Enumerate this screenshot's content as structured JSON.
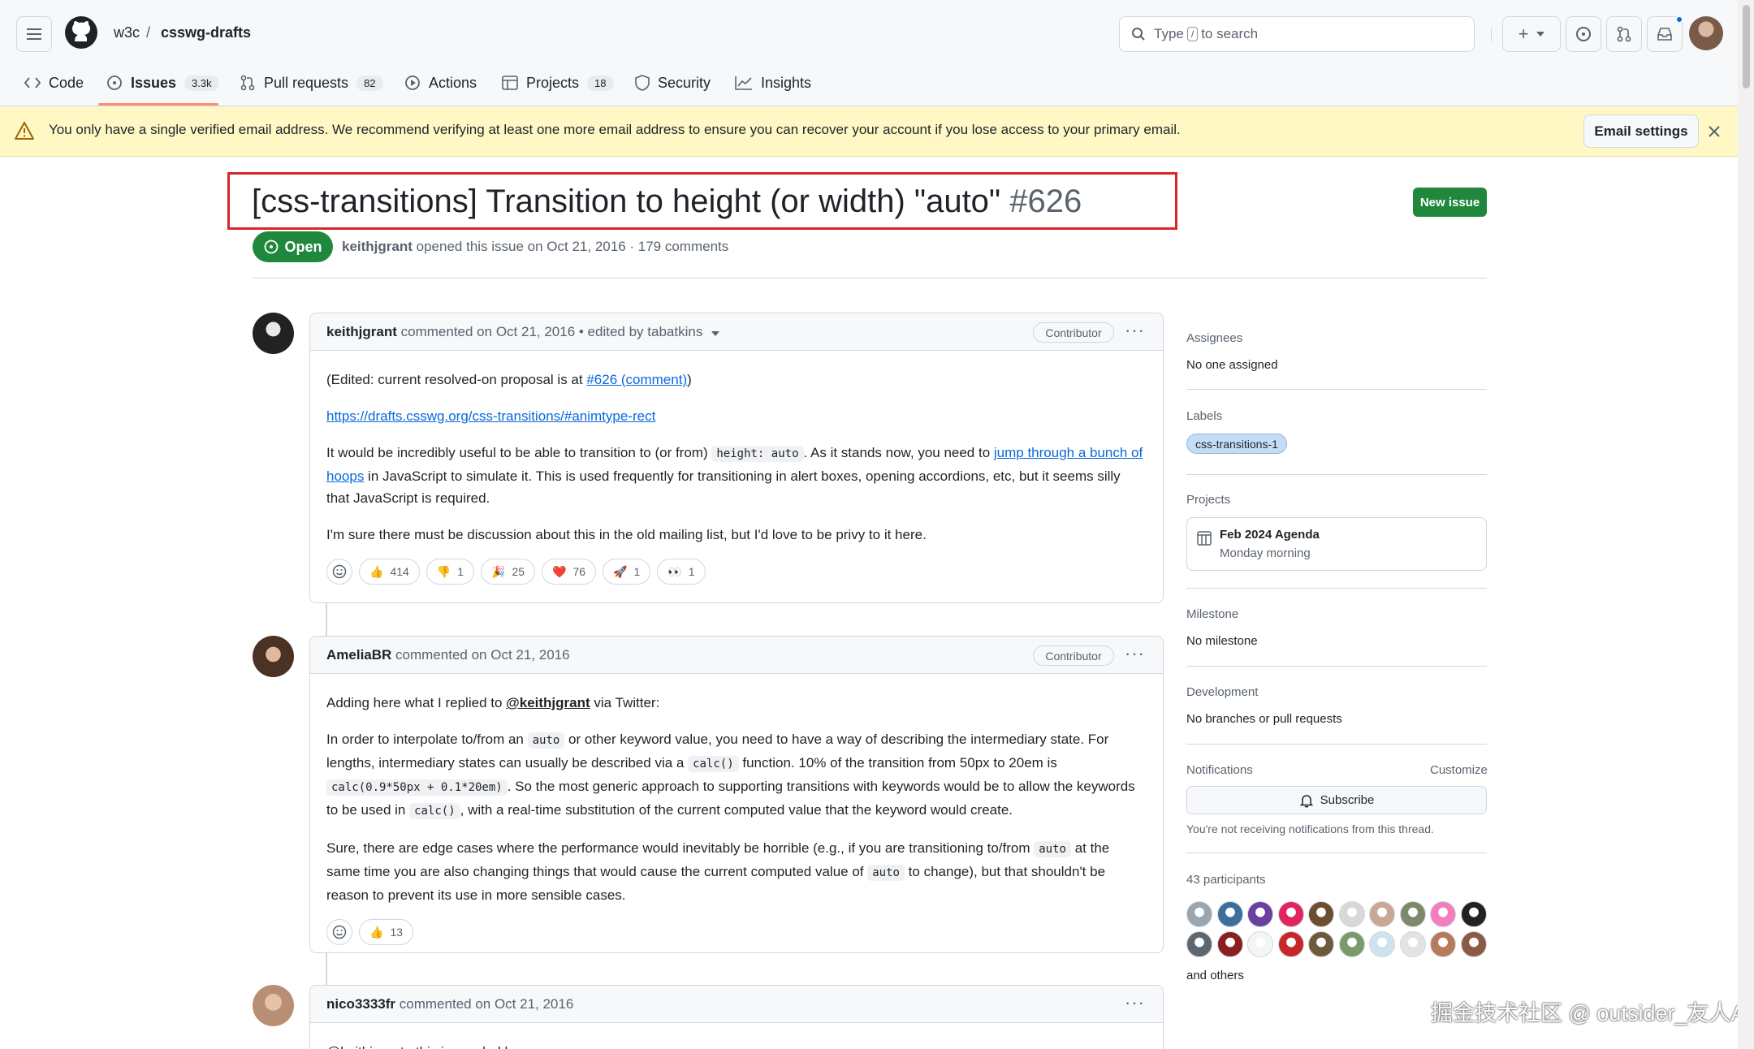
{
  "header": {
    "org": "w3c",
    "separator": "/",
    "repo": "csswg-drafts",
    "search_prefix": "Type",
    "search_key": "/",
    "search_suffix": "to search",
    "plus": "+",
    "tabs": [
      {
        "label": "Code"
      },
      {
        "label": "Issues",
        "count": "3.3k"
      },
      {
        "label": "Pull requests",
        "count": "82"
      },
      {
        "label": "Actions"
      },
      {
        "label": "Projects",
        "count": "18"
      },
      {
        "label": "Security"
      },
      {
        "label": "Insights"
      }
    ]
  },
  "banner": {
    "text": "You only have a single verified email address. We recommend verifying at least one more email address to ensure you can recover your account if you lose access to your primary email.",
    "button": "Email settings"
  },
  "issue": {
    "title": "[css-transitions] Transition to height (or width) \"auto\"",
    "number": "#626",
    "new_issue": "New issue",
    "state": "Open",
    "author": "keithjgrant",
    "meta": "opened this issue on Oct 21, 2016 · 179 comments"
  },
  "comments": [
    {
      "author": "keithjgrant",
      "meta": "commented on Oct 21, 2016 • edited by tabatkins",
      "badge": "Contributor",
      "p1_pre": "(Edited: current resolved-on proposal is at ",
      "p1_link": "#626 (comment)",
      "p1_post": ")",
      "p2_link": "https://drafts.csswg.org/css-transitions/#animtype-rect",
      "p3_a": "It would be incredibly useful to be able to transition to (or from) ",
      "p3_code": "height: auto",
      "p3_b": ". As it stands now, you need to ",
      "p3_link": "jump through a bunch of hoops",
      "p3_c": " in JavaScript to simulate it. This is used frequently for transitioning in alert boxes, opening accordions, etc, but it seems silly that JavaScript is required.",
      "p4": "I'm sure there must be discussion about this in the old mailing list, but I'd love to be privy to it here.",
      "reactions": [
        {
          "emoji": "👍",
          "count": "414"
        },
        {
          "emoji": "👎",
          "count": "1"
        },
        {
          "emoji": "🎉",
          "count": "25"
        },
        {
          "emoji": "❤️",
          "count": "76"
        },
        {
          "emoji": "🚀",
          "count": "1"
        },
        {
          "emoji": "👀",
          "count": "1"
        }
      ]
    },
    {
      "author": "AmeliaBR",
      "meta": "commented on Oct 21, 2016",
      "badge": "Contributor",
      "p1_a": "Adding here what I replied to ",
      "p1_link": "@keithjgrant",
      "p1_b": " via Twitter:",
      "p2_a": "In order to interpolate to/from an ",
      "p2_code1": "auto",
      "p2_b": " or other keyword value, you need to have a way of describing the intermediary state. For lengths, intermediary states can usually be described via a ",
      "p2_code2": "calc()",
      "p2_c": " function. 10% of the transition from 50px to 20em is ",
      "p2_code3": "calc(0.9*50px + 0.1*20em)",
      "p2_d": ". So the most generic approach to supporting transitions with keywords would be to allow the keywords to be used in ",
      "p2_code4": "calc()",
      "p2_e": ", with a real-time substitution of the current computed value that the keyword would create.",
      "p3_a": "Sure, there are edge cases where the performance would inevitably be horrible (e.g., if you are transitioning to/from ",
      "p3_code1": "auto",
      "p3_b": " at the same time you are also changing things that would cause the current computed value of ",
      "p3_code2": "auto",
      "p3_c": " to change), but that shouldn't be reason to prevent its use in more sensible cases.",
      "reactions": [
        {
          "emoji": "👍",
          "count": "13"
        }
      ]
    },
    {
      "author": "nico3333fr",
      "meta": "commented on Oct 21, 2016",
      "body_start": "@keithjgrant : this is needed because"
    }
  ],
  "sidebar": {
    "assignees_h": "Assignees",
    "assignees_v": "No one assigned",
    "labels_h": "Labels",
    "label": "css-transitions-1",
    "projects_h": "Projects",
    "project_name": "Feb 2024 Agenda",
    "project_status": "Monday morning",
    "milestone_h": "Milestone",
    "milestone_v": "No milestone",
    "development_h": "Development",
    "development_v": "No branches or pull requests",
    "notifications_h": "Notifications",
    "customize": "Customize",
    "subscribe": "Subscribe",
    "notif_note": "You're not receiving notifications from this thread.",
    "participants_h": "43 participants",
    "and_others": "and others"
  },
  "watermark": "掘金技术社区 @ outsider_友人A",
  "colors": {
    "accent_green": "#1f883d",
    "link_blue": "#0969da",
    "banner_yellow": "#fff8c5",
    "highlight_red": "#d9262a"
  }
}
